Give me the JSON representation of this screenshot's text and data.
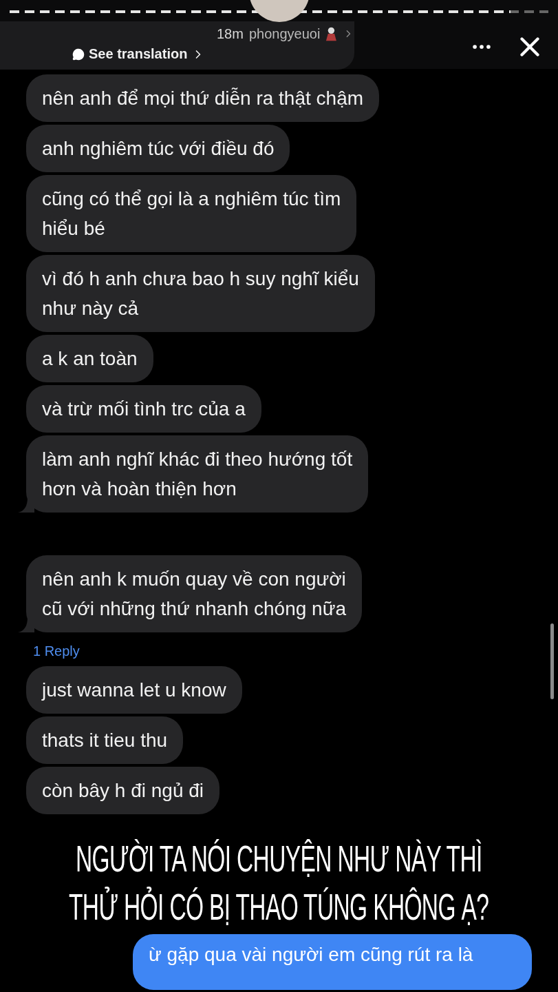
{
  "header": {
    "story_progress": {
      "level": 0.93
    },
    "time": "18m",
    "username": "phongyeuoi",
    "translation_link": "See translation"
  },
  "message_groups": [
    {
      "messages": [
        {
          "lines": [
            "nên anh để mọi thứ diễn ra thật chậm"
          ]
        },
        {
          "lines": [
            "anh nghiêm túc với điều đó"
          ]
        },
        {
          "lines": [
            "cũng có thể gọi là a nghiêm túc tìm",
            "hiểu bé"
          ]
        },
        {
          "lines": [
            "vì đó h anh chưa bao h suy nghĩ kiểu",
            "như này cả"
          ]
        },
        {
          "lines": [
            "a k an toàn"
          ]
        },
        {
          "lines": [
            "và trừ mối tình trc của a"
          ]
        },
        {
          "lines": [
            "làm anh nghĩ khác đi theo hướng tốt",
            "hơn và hoàn thiện hơn"
          ]
        }
      ]
    },
    {
      "messages": [
        {
          "lines": [
            "nên anh k muốn quay về con người",
            "cũ với những thứ nhanh chóng nữa"
          ]
        }
      ],
      "reply_count": "1 Reply"
    },
    {
      "messages": [
        {
          "lines": [
            "just wanna let u know"
          ]
        },
        {
          "lines": [
            "thats it tieu thu"
          ]
        },
        {
          "lines": [
            "còn bây h đi ngủ đi"
          ]
        }
      ]
    }
  ],
  "caption": [
    "NGƯỜI TA NÓI CHUYỆN NHƯ NÀY THÌ",
    "THỬ HỎI CÓ BỊ THAO TÚNG KHÔNG Ạ?"
  ],
  "sent_message": {
    "lines": [
      "ừ gặp qua vài người em cũng rút ra là"
    ]
  }
}
